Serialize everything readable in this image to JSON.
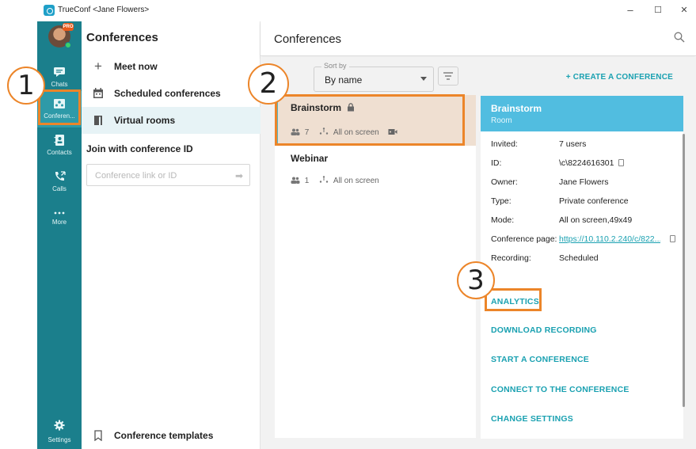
{
  "window": {
    "title": "TrueConf <Jane Flowers>",
    "minimize": "–",
    "maximize": "☐",
    "close": "✕"
  },
  "sidebar": {
    "badge": "PRO",
    "items": [
      {
        "label": "Chats",
        "icon": "chat-icon"
      },
      {
        "label": "Conferen...",
        "icon": "conferences-icon"
      },
      {
        "label": "Contacts",
        "icon": "contacts-icon"
      },
      {
        "label": "Calls",
        "icon": "calls-icon"
      },
      {
        "label": "More",
        "icon": "more-icon"
      },
      {
        "label": "Settings",
        "icon": "gear-icon"
      }
    ]
  },
  "left": {
    "title": "Conferences",
    "items": [
      {
        "label": "Meet now",
        "icon": "plus-icon"
      },
      {
        "label": "Scheduled conferences",
        "icon": "calendar-icon"
      },
      {
        "label": "Virtual rooms",
        "icon": "door-icon"
      }
    ],
    "join_label": "Join with conference ID",
    "join_placeholder": "Conference link or ID",
    "templates": "Conference templates"
  },
  "main": {
    "title": "Conferences",
    "sort_legend": "Sort by",
    "sort_value": "By name",
    "create": "+ CREATE A CONFERENCE",
    "conferences": [
      {
        "name": "Brainstorm",
        "count": "7",
        "mode": "All on screen"
      },
      {
        "name": "Webinar",
        "count": "1",
        "mode": "All on screen"
      }
    ]
  },
  "details": {
    "title": "Brainstorm",
    "subtitle": "Room",
    "rows": [
      {
        "k": "Invited:",
        "v": "7 users"
      },
      {
        "k": "ID:",
        "v": "\\c\\8224616301"
      },
      {
        "k": "Owner:",
        "v": "Jane Flowers"
      },
      {
        "k": "Type:",
        "v": "Private conference"
      },
      {
        "k": "Mode:",
        "v": "All on screen,49x49"
      },
      {
        "k": "Conference page:",
        "v": "https://10.110.2.240/c/822..."
      },
      {
        "k": "Recording:",
        "v": "Scheduled"
      }
    ],
    "actions": [
      "ANALYTICS",
      "DOWNLOAD RECORDING",
      "START A CONFERENCE",
      "CONNECT TO THE CONFERENCE",
      "CHANGE SETTINGS"
    ]
  },
  "annotations": [
    "1",
    "2",
    "3"
  ],
  "colors": {
    "accent": "#1aa1b1",
    "sidebar": "#1b7f8c",
    "highlight": "#ec8529",
    "header": "#51bde0"
  }
}
